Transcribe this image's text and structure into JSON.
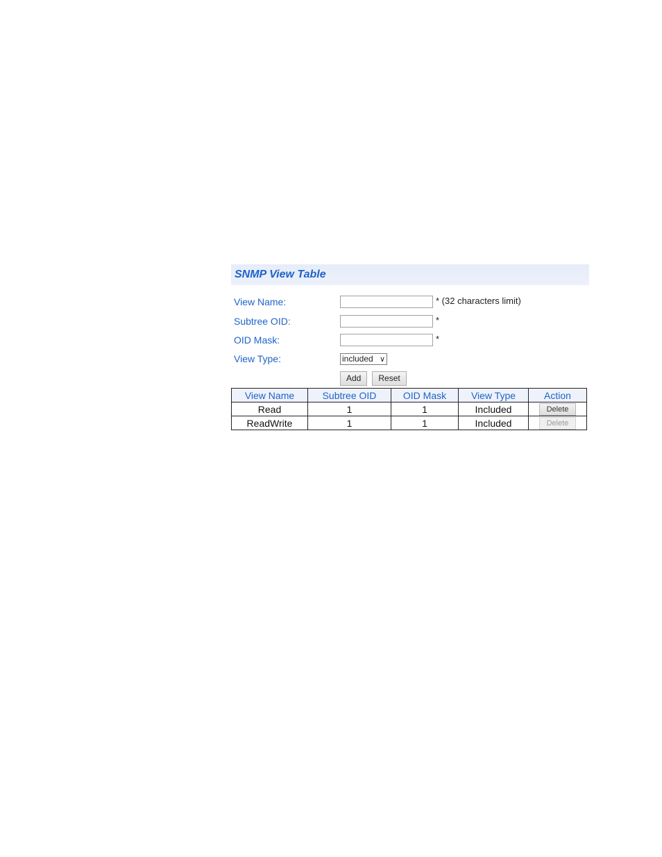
{
  "title": "SNMP View Table",
  "form": {
    "view_name": {
      "label": "View Name:",
      "value": "",
      "note": "* (32 characters limit)"
    },
    "subtree_oid": {
      "label": "Subtree OID:",
      "value": "",
      "note": "*"
    },
    "oid_mask": {
      "label": "OID Mask:",
      "value": "",
      "note": "*"
    },
    "view_type": {
      "label": "View Type:",
      "selected": "included"
    },
    "add_label": "Add",
    "reset_label": "Reset"
  },
  "table": {
    "headers": [
      "View Name",
      "Subtree OID",
      "OID Mask",
      "View Type",
      "Action"
    ],
    "rows": [
      {
        "view_name": "Read",
        "subtree_oid": "1",
        "oid_mask": "1",
        "view_type": "Included",
        "action": "Delete",
        "action_enabled": true
      },
      {
        "view_name": "ReadWrite",
        "subtree_oid": "1",
        "oid_mask": "1",
        "view_type": "Included",
        "action": "Delete",
        "action_enabled": false
      }
    ]
  }
}
